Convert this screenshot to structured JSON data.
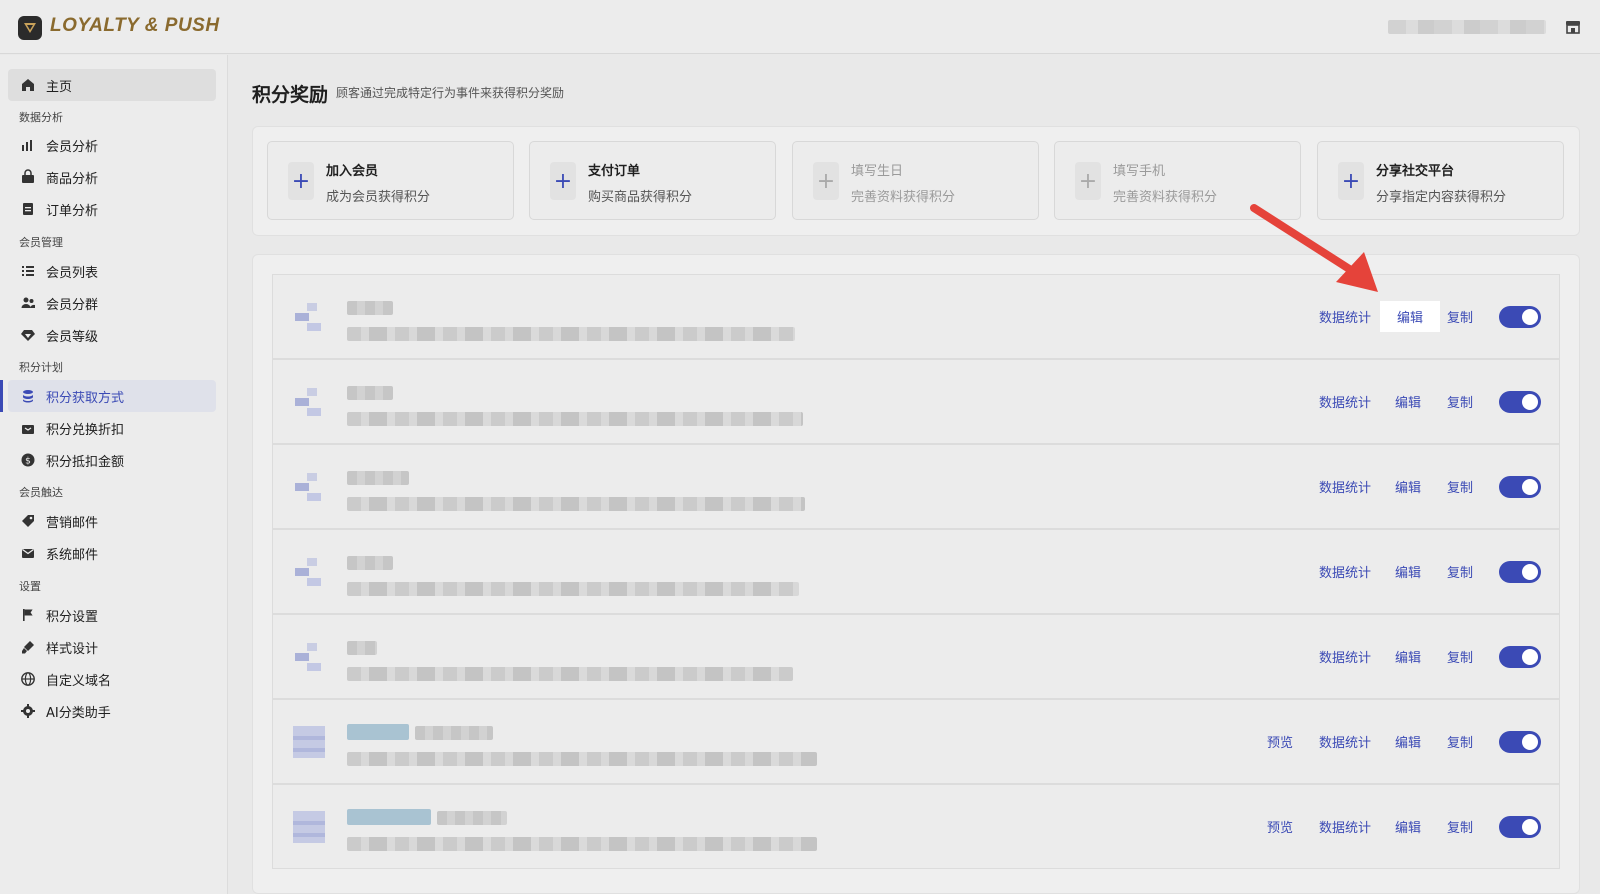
{
  "app": {
    "logo_text": "LOYALTY & PUSH"
  },
  "sidebar": {
    "home": "主页",
    "sections": {
      "analytics": "数据分析",
      "members": "会员管理",
      "points": "积分计划",
      "reach": "会员触达",
      "settings": "设置"
    },
    "items": {
      "member_analysis": "会员分析",
      "product_analysis": "商品分析",
      "order_analysis": "订单分析",
      "member_list": "会员列表",
      "member_groups": "会员分群",
      "member_levels": "会员等级",
      "points_earning": "积分获取方式",
      "points_discount": "积分兑换折扣",
      "points_amount": "积分抵扣金额",
      "marketing_email": "营销邮件",
      "system_email": "系统邮件",
      "points_settings": "积分设置",
      "style_design": "样式设计",
      "custom_domain": "自定义域名",
      "ai_assistant": "AI分类助手"
    }
  },
  "page": {
    "title": "积分奖励",
    "subtitle": "顾客通过完成特定行为事件来获得积分奖励"
  },
  "cards": [
    {
      "title": "加入会员",
      "sub": "成为会员获得积分"
    },
    {
      "title": "支付订单",
      "sub": "购买商品获得积分"
    },
    {
      "title": "填写生日",
      "sub": "完善资料获得积分"
    },
    {
      "title": "填写手机",
      "sub": "完善资料获得积分"
    },
    {
      "title": "分享社交平台",
      "sub": "分享指定内容获得积分"
    }
  ],
  "actions": {
    "preview": "预览",
    "stats": "数据统计",
    "edit": "编辑",
    "copy": "复制"
  },
  "colors": {
    "accent": "#3b4ab5",
    "annotation_arrow": "#e5433a"
  }
}
